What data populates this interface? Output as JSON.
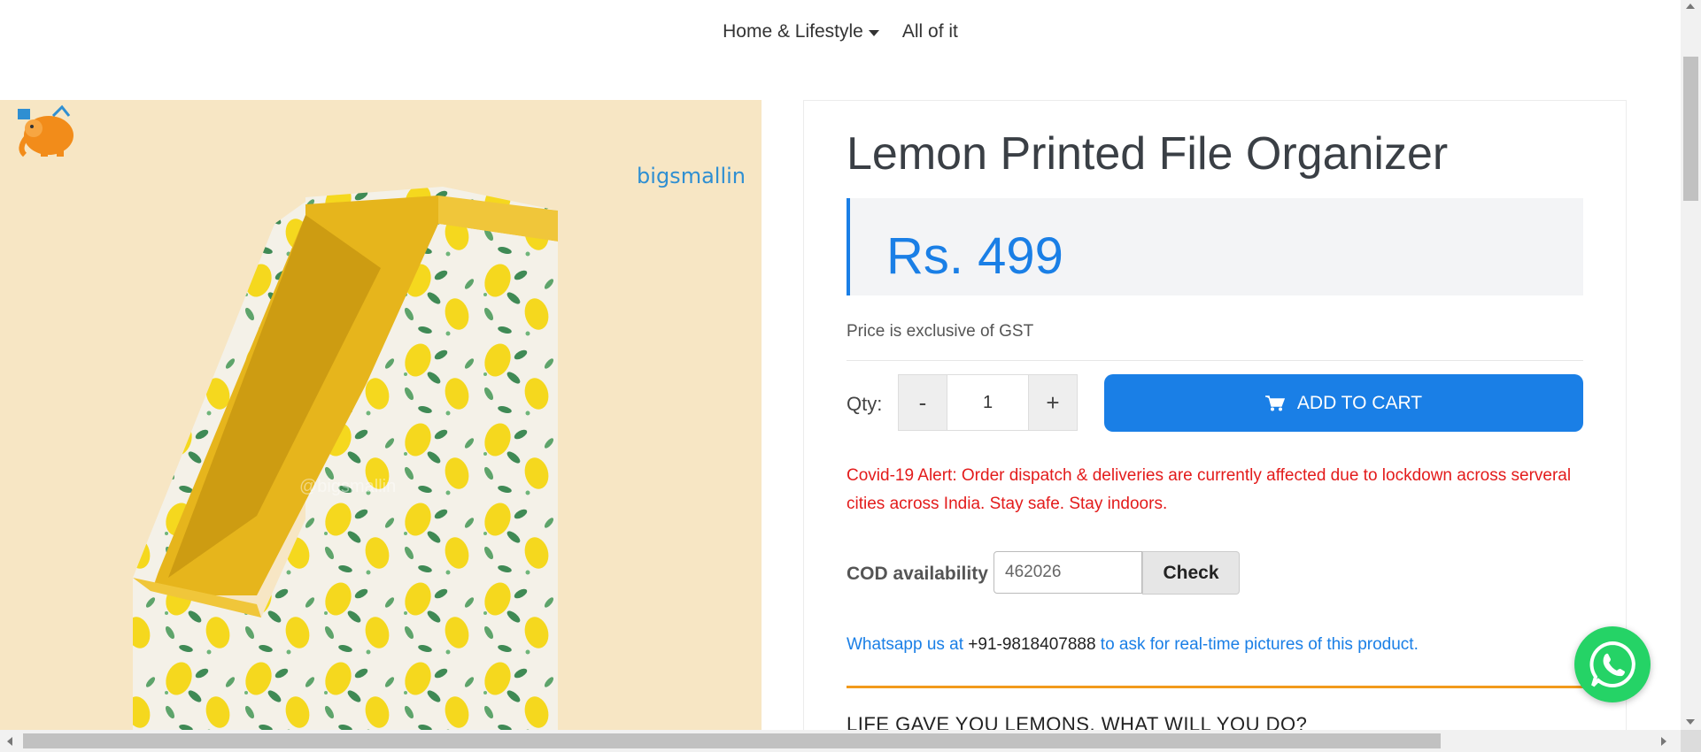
{
  "nav": {
    "items": [
      {
        "label": "Home & Lifestyle",
        "has_dropdown": true
      },
      {
        "label": "All of it",
        "has_dropdown": false
      }
    ]
  },
  "product_image": {
    "brand": "bigsmallin",
    "watermark": "@bigsmallin",
    "background_color": "#f7e6c4",
    "icons": [
      "elephant-logo-icon"
    ]
  },
  "product": {
    "title": "Lemon Printed File Organizer",
    "price": "Rs. 499",
    "gst_note": "Price is exclusive of GST",
    "qty_label": "Qty:",
    "qty_minus": "-",
    "qty_value": "1",
    "qty_plus": "+",
    "add_to_cart": "ADD TO CART",
    "alert": "Covid-19 Alert: Order dispatch & deliveries are currently affected due to lockdown across serveral cities across India. Stay safe. Stay indoors.",
    "cod_label": "COD availability",
    "cod_value": "462026",
    "cod_check": "Check",
    "whatsapp_prefix": "Whatsapp us at ",
    "whatsapp_phone": "+91-9818407888",
    "whatsapp_suffix": " to ask for real-time pictures of this product.",
    "section_heading": "LIFE GAVE YOU LEMONS, WHAT WILL YOU DO?"
  },
  "colors": {
    "accent": "#1a7fe6",
    "alert": "#e31b1b",
    "divider": "#f29a1c",
    "whatsapp": "#25d366"
  },
  "icons": {
    "cart": "cart-icon",
    "whatsapp": "whatsapp-icon",
    "caret": "caret-down-icon"
  }
}
